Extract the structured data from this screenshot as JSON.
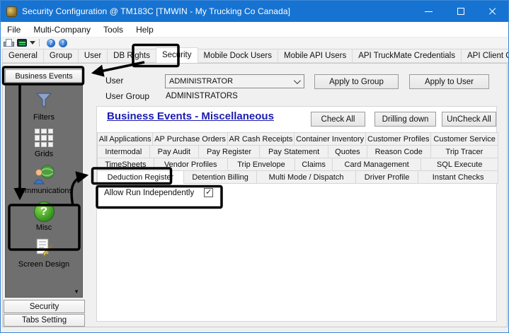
{
  "window": {
    "title": "Security Configuration @ TM183C [TMWIN - My Trucking Co Canada]"
  },
  "menu": {
    "items": [
      {
        "label": "File"
      },
      {
        "label": "Multi-Company"
      },
      {
        "label": "Tools"
      },
      {
        "label": "Help"
      }
    ]
  },
  "toolbar": {
    "icons": [
      "print-icon",
      "multi-company-icon",
      "dropdown-caret-icon",
      "help-icon",
      "about-icon"
    ],
    "help_glyph": "?",
    "about_glyph": "!"
  },
  "tabs": {
    "selected": "Security",
    "items": [
      {
        "label": "General"
      },
      {
        "label": "Group"
      },
      {
        "label": "User"
      },
      {
        "label": "DB Rights"
      },
      {
        "label": "Security"
      },
      {
        "label": "Mobile Dock Users"
      },
      {
        "label": "Mobile API Users"
      },
      {
        "label": "API TruckMate Credentials"
      },
      {
        "label": "API Client Credentials"
      }
    ]
  },
  "sidebar": {
    "top_button": "Business Events",
    "items": [
      {
        "label": "Filters",
        "icon": "filter-icon"
      },
      {
        "label": "Grids",
        "icon": "grid-icon"
      },
      {
        "label": "Communications",
        "icon": "communications-icon"
      },
      {
        "label": "Misc",
        "icon": "misc-help-icon"
      },
      {
        "label": "Screen Design",
        "icon": "screen-design-icon"
      }
    ],
    "misc_glyph": "?",
    "scroll_down_glyph": "▼",
    "bottom_buttons": [
      {
        "label": "Security"
      },
      {
        "label": "Tabs Setting"
      }
    ]
  },
  "main": {
    "user_label": "User",
    "user_value": "ADMINISTRATOR",
    "user_group_label": "User Group",
    "user_group_value": "ADMINISTRATORS",
    "apply_to_group": "Apply to Group",
    "apply_to_user": "Apply to User",
    "heading": "Business Events - Miscellaneous",
    "check_all": "Check All",
    "drilling_down": "Drilling down",
    "uncheck_all": "UnCheck All",
    "category_tabs": {
      "selected": "Deduction Register",
      "row1": [
        "All Applications",
        "AP Purchase Orders",
        "AR Cash Receipts",
        "Container Inventory",
        "Customer Profiles",
        "Customer Service"
      ],
      "row2": [
        "Intermodal",
        "Pay Audit",
        "Pay Register",
        "Pay Statement",
        "Quotes",
        "Reason Code",
        "Trip Tracer"
      ],
      "row3": [
        "TimeSheets",
        "Vendor Profiles",
        "Trip Envelope",
        "Claims",
        "Card Management",
        "SQL Execute"
      ],
      "row4": [
        "Deduction Register",
        "Detention Billing",
        "Multi Mode / Dispatch",
        "Driver Profile",
        "Instant Checks"
      ]
    },
    "checkbox": {
      "label": "Allow Run Independently",
      "checked": true,
      "check_glyph": "✓"
    }
  },
  "colors": {
    "titlebar": "#1673d1",
    "heading": "#1c1cb0",
    "sidebar_panel": "#6f6f6f",
    "annotation": "#000000"
  }
}
